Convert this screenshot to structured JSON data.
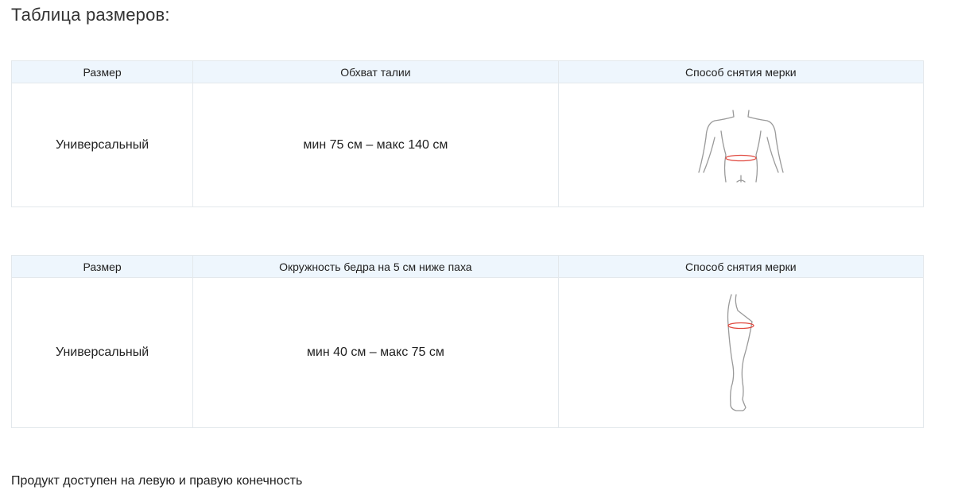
{
  "page": {
    "title": "Таблица размеров:",
    "footer_note": "Продукт доступен на левую и правую конечность"
  },
  "tables": [
    {
      "headers": {
        "size": "Размер",
        "measurement": "Обхват талии",
        "method": "Способ снятия мерки"
      },
      "row": {
        "size": "Универсальный",
        "range": "мин 75 см – макс 140 см",
        "figure_icon": "torso-waist-figure"
      }
    },
    {
      "headers": {
        "size": "Размер",
        "measurement": "Окружность бедра на 5 см ниже паха",
        "method": "Способ снятия мерки"
      },
      "row": {
        "size": "Универсальный",
        "range": "мин 40 см – макс 75 см",
        "figure_icon": "leg-thigh-figure"
      }
    }
  ],
  "colors": {
    "header_background": "#eef6fd",
    "border": "#e3e8ec",
    "figure_outline": "#9a9a9a",
    "measure_line": "#e0463c"
  }
}
